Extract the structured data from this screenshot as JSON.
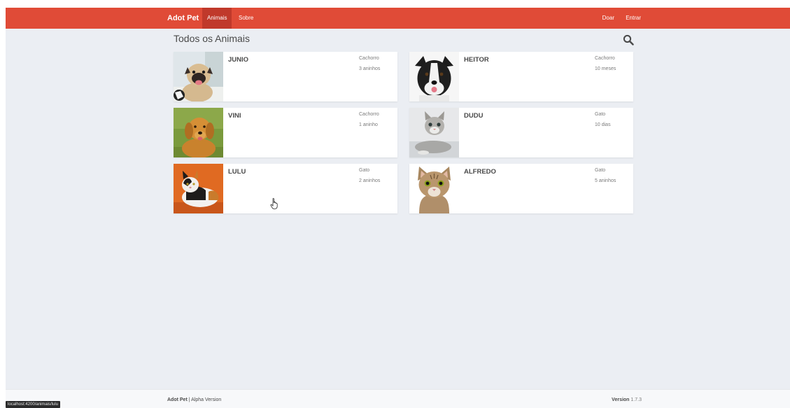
{
  "navbar": {
    "brand": "Adot Pet",
    "links": {
      "animals": "Animais",
      "about": "Sobre",
      "donate": "Doar",
      "login": "Entrar"
    }
  },
  "main": {
    "title": "Todos os Animais",
    "search_icon": "search-icon",
    "cards": [
      {
        "name": "JUNIO",
        "species": "Cachorro",
        "age": "3 aninhos",
        "photo": "pug"
      },
      {
        "name": "HEITOR",
        "species": "Cachorro",
        "age": "10 meses",
        "photo": "border-collie"
      },
      {
        "name": "VINI",
        "species": "Cachorro",
        "age": "1 aninho",
        "photo": "golden-retriever"
      },
      {
        "name": "DUDU",
        "species": "Gato",
        "age": "10 dias",
        "photo": "tabby-kitten"
      },
      {
        "name": "LULU",
        "species": "Gato",
        "age": "2 aninhos",
        "photo": "calico-cat"
      },
      {
        "name": "ALFREDO",
        "species": "Gato",
        "age": "5 aninhos",
        "photo": "tabby-cat"
      }
    ]
  },
  "footer": {
    "brand": "Adot Pet",
    "separator": " | ",
    "edition": "Alpha Version",
    "version_label": "Version",
    "version": "1.7.3"
  },
  "status_bar": {
    "url": "localhost:4200/animais/lulu"
  },
  "colors": {
    "primary": "#e04b37",
    "active": "#c0392b",
    "background": "#ebeef3"
  }
}
